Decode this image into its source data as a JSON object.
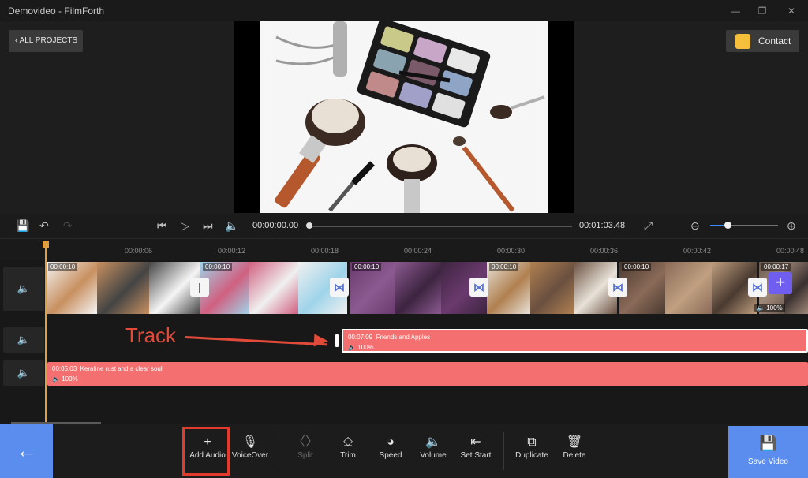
{
  "window": {
    "title": "Demovideo - FilmForth",
    "minimize": "—",
    "restore": "❐",
    "close": "✕"
  },
  "header": {
    "all_projects": "ALL PROJECTS",
    "contact": "Contact"
  },
  "player": {
    "current_time": "00:00:00.00",
    "total_time": "00:01:03.48",
    "progress": 0.0,
    "zoom_level": 0.25
  },
  "ruler": {
    "ticks": [
      "00:00:06",
      "00:00:12",
      "00:00:18",
      "00:00:24",
      "00:00:30",
      "00:00:36",
      "00:00:42",
      "00:00:48"
    ]
  },
  "video_clips": [
    {
      "duration": "00:00:10",
      "colors": [
        "#f5f5f5",
        "#c89060",
        "#444444"
      ]
    },
    {
      "duration": "00:00:10",
      "colors": [
        "#9fd4ea",
        "#d06080",
        "#f0f0f0"
      ]
    },
    {
      "duration": "00:00:10",
      "colors": [
        "#6a3a6e",
        "#8b5a90",
        "#3d2440"
      ]
    },
    {
      "duration": "00:00:10",
      "colors": [
        "#e8e2d8",
        "#b08050",
        "#6a5040"
      ]
    },
    {
      "duration": "00:00:10",
      "colors": [
        "#4a3a30",
        "#8a6a58",
        "#c0a080"
      ]
    },
    {
      "duration": "00:00:17",
      "colors": [
        "#6a5a50",
        "#a08878",
        "#3a3030"
      ]
    }
  ],
  "video_volume": "100%",
  "audio_tracks": [
    {
      "duration": "00:07:09",
      "name": "Friends and Apples",
      "volume": "100%"
    },
    {
      "duration": "00:05:03",
      "name": "Keratine rust and a clear soul",
      "volume": "100%"
    }
  ],
  "annotation": {
    "label": "Track"
  },
  "toolbar": {
    "add_audio": "Add Audio",
    "voiceover": "VoiceOver",
    "split": "Split",
    "trim": "Trim",
    "speed": "Speed",
    "volume": "Volume",
    "set_start": "Set Start",
    "duplicate": "Duplicate",
    "delete": "Delete",
    "save_video": "Save Video"
  },
  "colors": {
    "accent": "#5b8def",
    "audio_clip": "#f46f6f",
    "playhead": "#e0a040",
    "highlight": "#e23b2e"
  }
}
